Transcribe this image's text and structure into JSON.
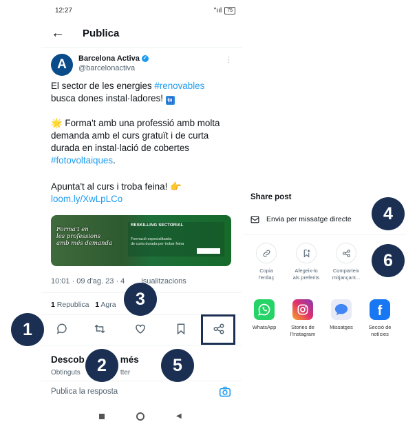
{
  "status": {
    "time": "12:27",
    "signal": "\"ııl",
    "battery": "75"
  },
  "header": {
    "title": "Publica"
  },
  "post": {
    "author_name": "Barcelona Activa",
    "author_handle": "@barcelonactiva",
    "avatar_letter": "A",
    "p1_a": "El sector de les energies ",
    "p1_hashtag": "#renovables",
    "p1_b": "busca dones instal·ladores! ",
    "p1_icon": "🚻",
    "p2_a": "🌟 Forma't amb una professió amb molta demanda amb el curs gratuït i de curta durada en instal·lació de cobertes ",
    "p2_hashtag": "#fotovoltaiques",
    "p2_b": ".",
    "p3_a": "Apunta't al curs i troba feina! 👉 ",
    "p3_link": "loom.ly/XwLpLCo",
    "media": {
      "left_l1": "Forma't en",
      "left_l2": "les professions",
      "left_l3": "amb més demanda",
      "title": "RESKILLING SECTORIAL",
      "sub_l1": "Formació especialitzada",
      "sub_l2": "de curta durada per trobar feina"
    },
    "meta": "10:01 · 09 d'ag. 23 · 4",
    "meta_rest": "isualitzacions",
    "stats_a_num": "1",
    "stats_a_label": "Republica",
    "stats_b_num": "1",
    "stats_b_label": "Agra"
  },
  "discover": {
    "title": "Descob",
    "title_rest": "més",
    "sub": "Obtinguts",
    "sub_rest": "tter"
  },
  "reply": {
    "placeholder": "Publica la resposta"
  },
  "share_sheet": {
    "title": "Share post",
    "dm_label": "Envia per missatge directe",
    "options": [
      {
        "l1": "Copia",
        "l2": "l'enllaç",
        "icon": "link-icon"
      },
      {
        "l1": "Afegeix-lo",
        "l2": "als preferits",
        "icon": "bookmark-add-icon"
      },
      {
        "l1": "Comparteix",
        "l2": "mitjançant...",
        "icon": "share-icon"
      }
    ],
    "apps": [
      {
        "l1": "WhatsApp",
        "l2": "",
        "color": "#25d366"
      },
      {
        "l1": "Stories de",
        "l2": "l'Instagram",
        "color": "#d6249f"
      },
      {
        "l1": "Missatges",
        "l2": "",
        "color": "#4285f4"
      },
      {
        "l1": "Secció de",
        "l2": "notícies",
        "color": "#1877f2"
      }
    ]
  },
  "callouts": [
    "1",
    "2",
    "3",
    "4",
    "5",
    "6"
  ],
  "colors": {
    "accent": "#1d9bf0",
    "callout": "#1a2f52"
  }
}
